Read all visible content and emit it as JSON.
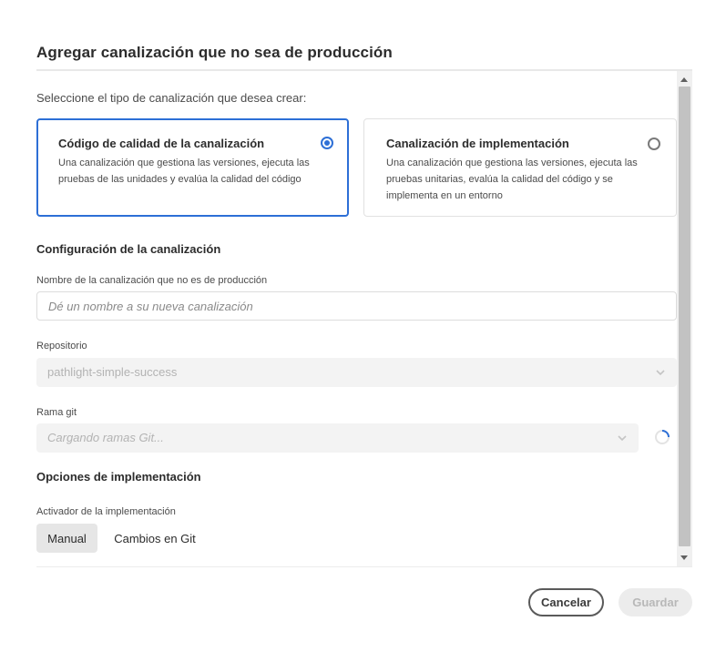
{
  "dialog": {
    "title": "Agregar canalización que no sea de producción"
  },
  "intro_text": "Seleccione el tipo de canalización que desea crear:",
  "pipeline_types": [
    {
      "title": "Código de calidad de la canalización",
      "description": "Una canalización que gestiona las versiones, ejecuta las pruebas de las unidades y evalúa la calidad del código",
      "selected": true
    },
    {
      "title": "Canalización de implementación",
      "description": "Una canalización que gestiona las versiones, ejecuta las pruebas unitarias, evalúa la calidad del código y se implementa en un entorno",
      "selected": false
    }
  ],
  "pipeline_config": {
    "heading": "Configuración de la canalización",
    "name_label": "Nombre de la canalización que no es de producción",
    "name_placeholder": "Dé un nombre a su nueva canalización",
    "name_value": "",
    "repository_label": "Repositorio",
    "repository_value": "pathlight-simple-success",
    "branch_label": "Rama git",
    "branch_placeholder": "Cargando ramas Git..."
  },
  "deployment_options": {
    "heading": "Opciones de implementación",
    "trigger_label": "Activador de la implementación",
    "trigger_options": [
      "Manual",
      "Cambios en Git"
    ],
    "trigger_selected": "Manual"
  },
  "footer": {
    "cancel_label": "Cancelar",
    "save_label": "Guardar"
  },
  "colors": {
    "accent": "#2d6fd6",
    "disabled_bg": "#f3f3f3",
    "disabled_text": "#b3b3b3"
  },
  "icons": {
    "radio_selected": "radio-checked-icon",
    "radio_unselected": "radio-unchecked-icon",
    "select_chevron": "chevron-down-icon",
    "loading": "spinner-icon"
  }
}
